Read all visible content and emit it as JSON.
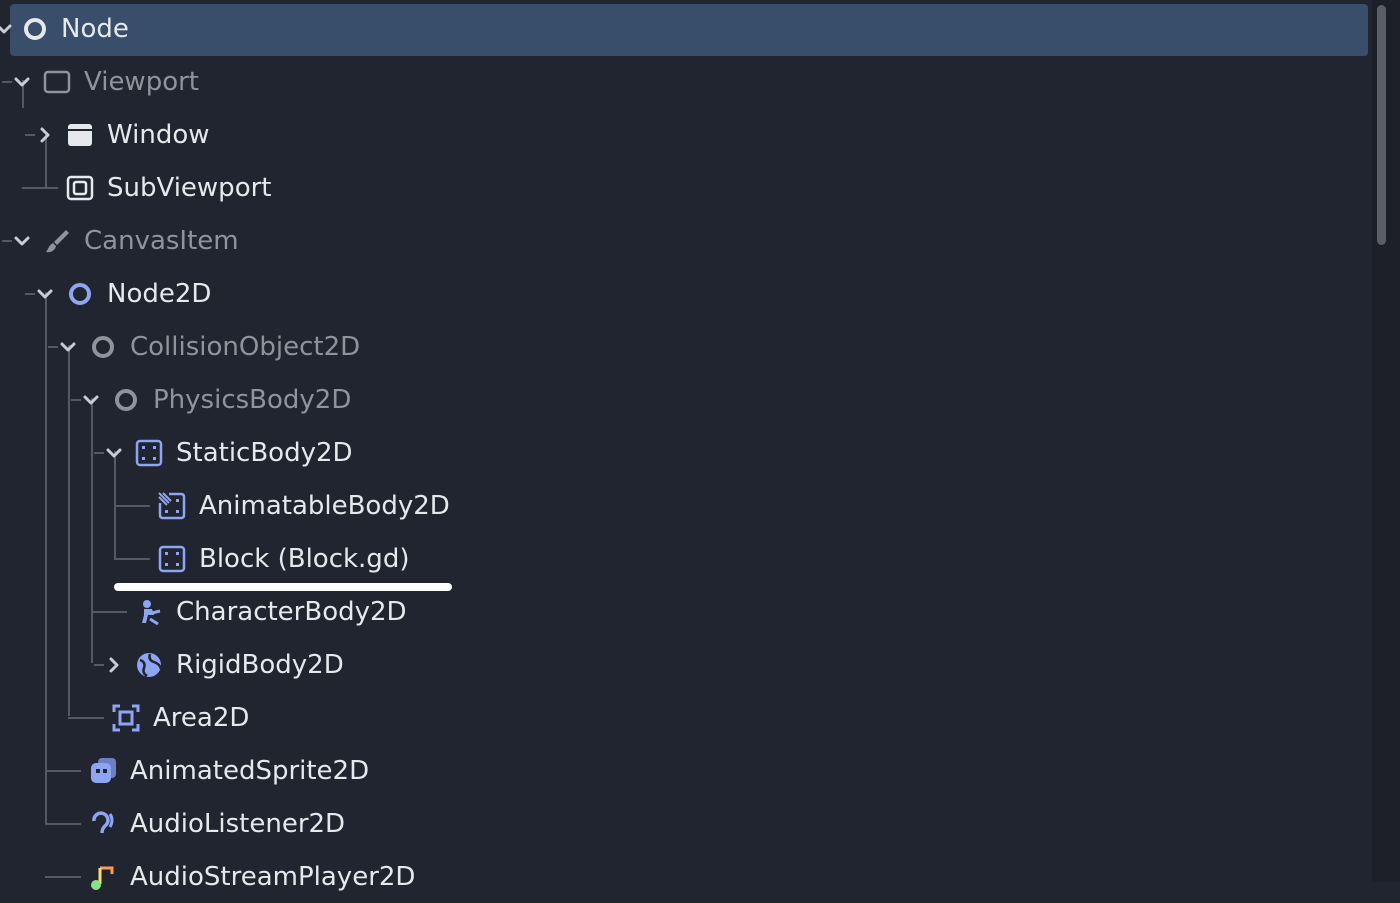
{
  "tree": {
    "nodes": [
      {
        "label": "Node",
        "icon": "node-icon",
        "dim": false,
        "selected": true,
        "expanded": true
      },
      {
        "label": "Viewport",
        "icon": "viewport-icon",
        "dim": true,
        "expanded": true
      },
      {
        "label": "Window",
        "icon": "window-icon",
        "dim": false,
        "expanded": false
      },
      {
        "label": "SubViewport",
        "icon": "subviewport-icon",
        "dim": false
      },
      {
        "label": "CanvasItem",
        "icon": "brush-icon",
        "dim": true,
        "expanded": true
      },
      {
        "label": "Node2D",
        "icon": "node2d-icon",
        "dim": false,
        "expanded": true
      },
      {
        "label": "CollisionObject2D",
        "icon": "collision-object-icon",
        "dim": true,
        "expanded": true
      },
      {
        "label": "PhysicsBody2D",
        "icon": "physics-body-icon",
        "dim": true,
        "expanded": true
      },
      {
        "label": "StaticBody2D",
        "icon": "static-body-icon",
        "dim": false,
        "expanded": true
      },
      {
        "label": "AnimatableBody2D",
        "icon": "animatable-body-icon",
        "dim": false
      },
      {
        "label": "Block (Block.gd)",
        "icon": "static-body-icon",
        "dim": false
      },
      {
        "label": "CharacterBody2D",
        "icon": "character-body-icon",
        "dim": false
      },
      {
        "label": "RigidBody2D",
        "icon": "rigid-body-icon",
        "dim": false,
        "expanded": false
      },
      {
        "label": "Area2D",
        "icon": "area-icon",
        "dim": false
      },
      {
        "label": "AnimatedSprite2D",
        "icon": "animated-sprite-icon",
        "dim": false
      },
      {
        "label": "AudioListener2D",
        "icon": "audio-listener-icon",
        "dim": false
      },
      {
        "label": "AudioStreamPlayer2D",
        "icon": "audio-stream-player-icon",
        "dim": false
      }
    ]
  },
  "colors": {
    "background": "#21252f",
    "selection": "#384e6a",
    "text": "#e6e8ec",
    "text_dim": "#8e939c",
    "icon_blue": "#8da5f3"
  }
}
